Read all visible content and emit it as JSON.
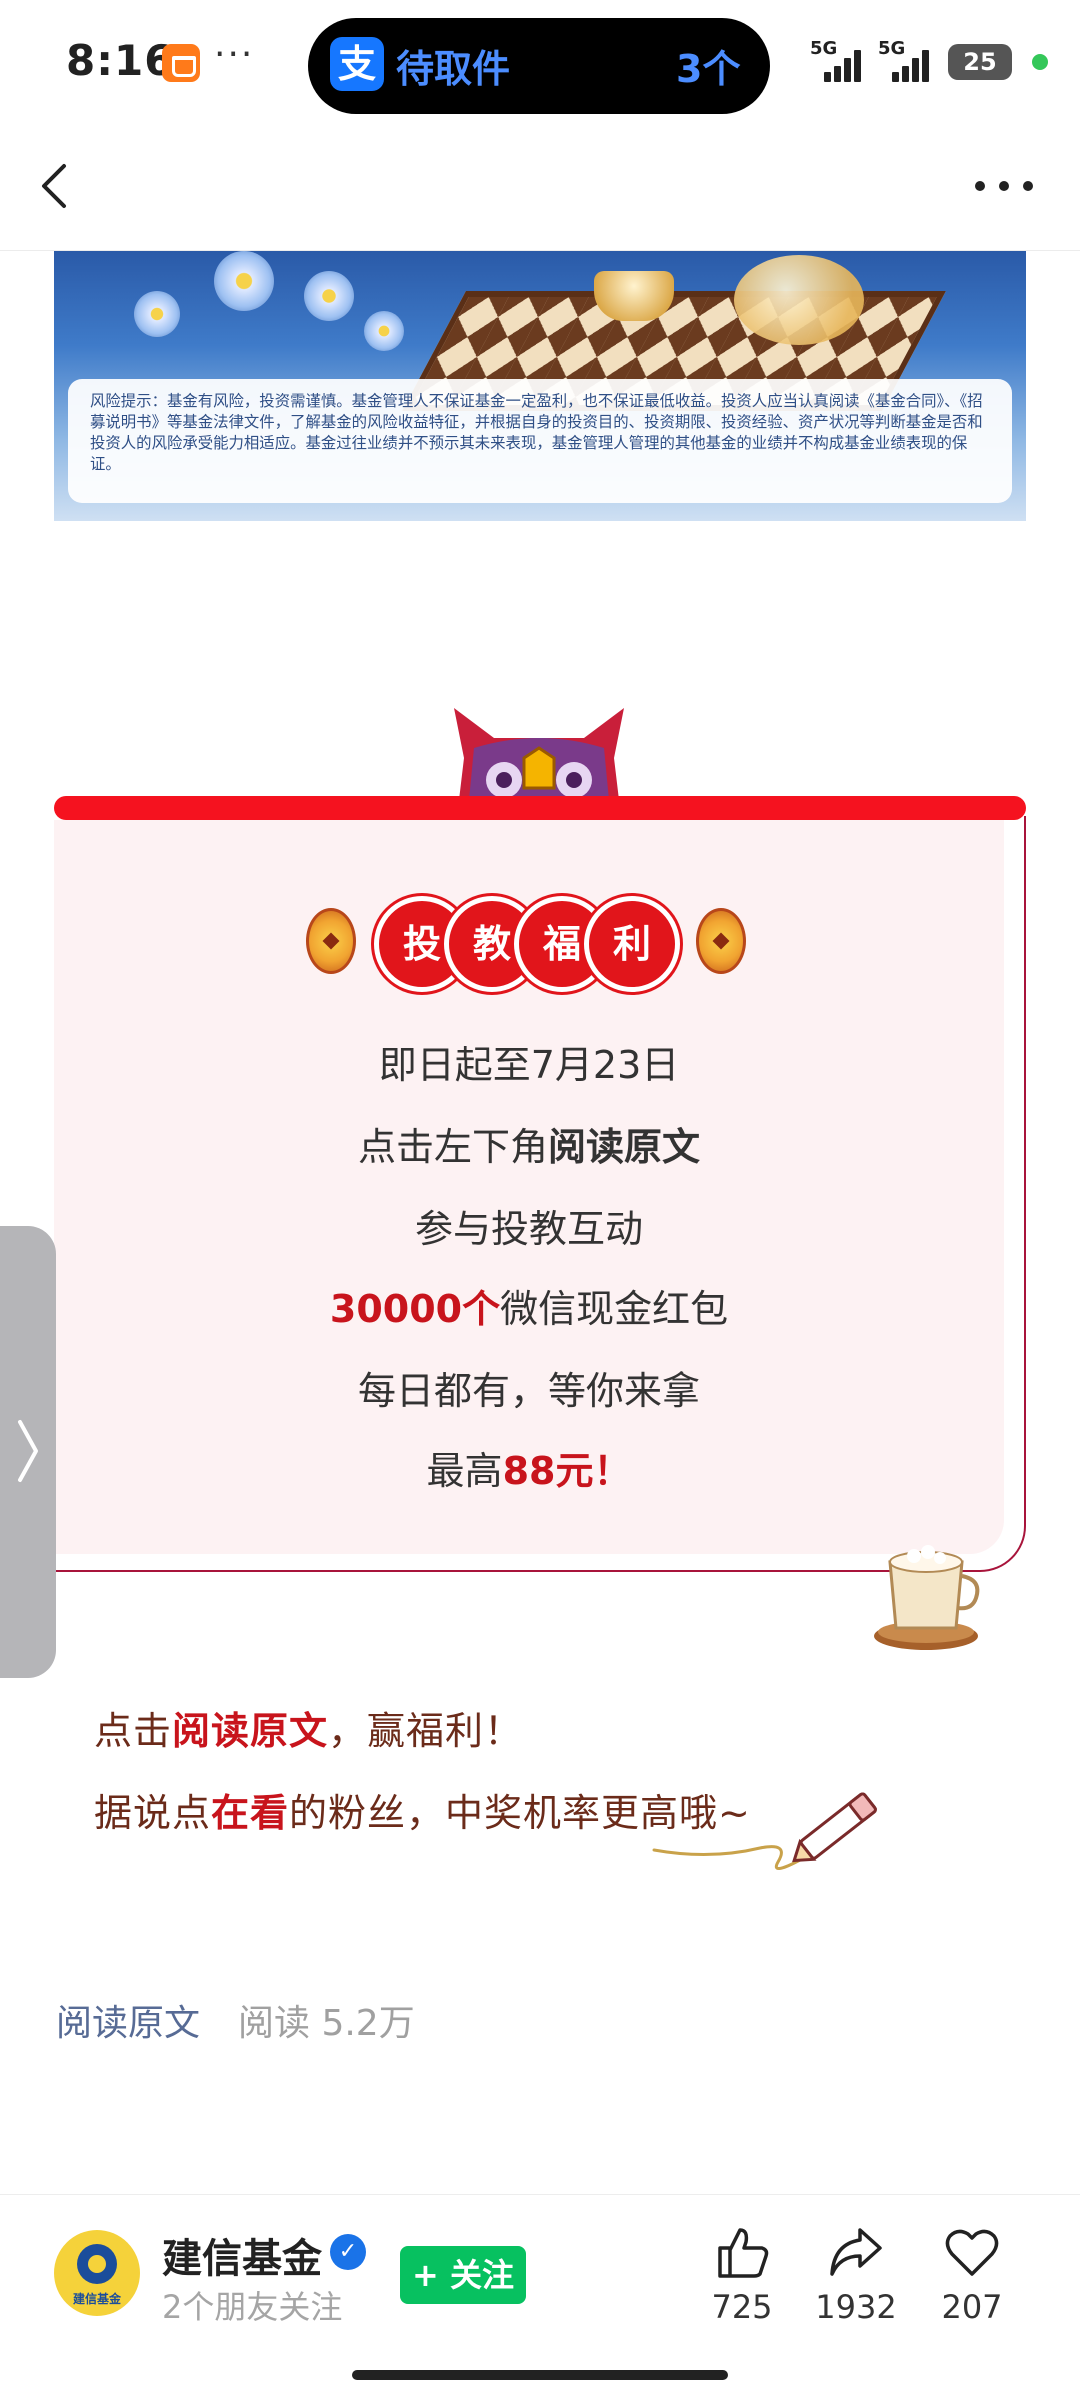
{
  "status_bar": {
    "time": "8:16",
    "more_glyph": "···",
    "pickup_icon_glyph": "支",
    "pickup_label": "待取件",
    "pickup_count": "3个",
    "signal1_label": "5G",
    "signal2_label": "5G",
    "battery": "25"
  },
  "navbar": {
    "back_icon": "chevron-left-icon",
    "more_icon": "more-horizontal-icon"
  },
  "banner": {
    "risk_notice": "风险提示：基金有风险，投资需谨慎。基金管理人不保证基金一定盈利，也不保证最低收益。投资人应当认真阅读《基金合同》、《招募说明书》等基金法律文件，了解基金的风险收益特征，并根据自身的投资目的、投资期限、投资经验、资产状况等判断基金是否和投资人的风险承受能力相适应。基金过往业绩并不预示其未来表现，基金管理人管理的其他基金的业绩并不构成基金业绩表现的保证。"
  },
  "card": {
    "badge_chars": [
      "投",
      "教",
      "福",
      "利"
    ],
    "line1": "即日起至7月23日",
    "line2_pre": "点击左下角",
    "line2_bold": "阅读原文",
    "line3": "参与投教互动",
    "line4_red": "30000个",
    "line4_rest": "微信现金红包",
    "line5": "每日都有，等你来拿",
    "line6_pre": "最高",
    "line6_red": "88元！"
  },
  "promo": {
    "line1_pre": "点击",
    "line1_hl": "阅读原文",
    "line1_post": "，赢福利！",
    "line2_pre": "据说点",
    "line2_hl": "在看",
    "line2_post": "的粉丝，中奖机率更高哦~"
  },
  "meta": {
    "read_original": "阅读原文",
    "reads": "阅读 5.2万"
  },
  "account": {
    "name": "建信基金",
    "logo_text": "建信基金",
    "verified_glyph": "✓",
    "friends": "2个朋友关注",
    "follow_label": "+ 关注"
  },
  "actions": [
    {
      "icon": "thumb-up-icon",
      "count": "725"
    },
    {
      "icon": "share-icon",
      "count": "1932"
    },
    {
      "icon": "heart-icon",
      "count": "207"
    }
  ],
  "colors": {
    "accent_red": "#c8141c",
    "follow_green": "#07c160",
    "link_blue": "#576b95"
  }
}
